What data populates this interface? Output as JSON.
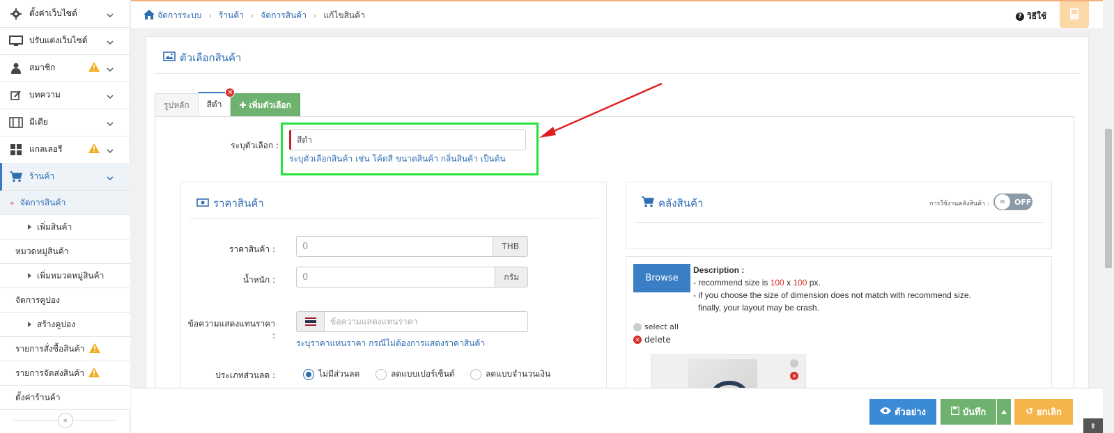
{
  "sidebar": {
    "items": [
      {
        "label": "ตั้งค่าเว็บไซต์",
        "icon": "gear-icon"
      },
      {
        "label": "ปรับแต่งเว็บไซต์",
        "icon": "monitor-icon"
      },
      {
        "label": "สมาชิก",
        "icon": "user-icon",
        "warning": true
      },
      {
        "label": "บทความ",
        "icon": "edit-icon"
      },
      {
        "label": "มีเดีย",
        "icon": "film-icon"
      },
      {
        "label": "แกลเลอรี",
        "icon": "grid-icon",
        "warning": true
      },
      {
        "label": "ร้านค้า",
        "icon": "cart-icon"
      }
    ],
    "shop_sub": [
      {
        "label": "จัดการสินค้า"
      },
      {
        "label": "เพิ่มสินค้า"
      },
      {
        "label": "หมวดหมู่สินค้า"
      },
      {
        "label": "เพิ่มหมวดหมู่สินค้า"
      },
      {
        "label": "จัดการคูปอง"
      },
      {
        "label": "สร้างคูปอง"
      },
      {
        "label": "รายการสั่งซื้อสินค้า"
      },
      {
        "label": "รายการจัดส่งสินค้า"
      },
      {
        "label": "ตั้งค่าร้านค้า"
      }
    ],
    "collapse_glyph": "«"
  },
  "breadcrumb": {
    "items": [
      "จัดการระบบ",
      "ร้านค้า",
      "จัดการสินค้า",
      "แก้ไขสินค้า"
    ]
  },
  "help_label": "วิธีใช้",
  "panel": {
    "title": "ตัวเลือกสินค้า",
    "tabs": [
      "รูปหลัก",
      "สีดำ",
      "เพิ่มตัวเลือก"
    ],
    "option_label": "ระบุตัวเลือก :",
    "option_value": "สีดำ",
    "option_help": "ระบุตัวเลือกสินค้า เช่น โค้ดสี ขนาดสินค้า กลิ่นสินค้า เป็นต้น"
  },
  "price": {
    "title": "ราคาสินค้า",
    "price_label": "ราคาสินค้า :",
    "price_value": "0",
    "price_unit": "THB",
    "weight_label": "น้ำหนัก :",
    "weight_value": "0",
    "weight_unit": "กรัม",
    "alt_label": "ข้อความแสดงแทนราคา",
    "alt_colon": ":",
    "alt_placeholder": "ข้อความแสดงแทนราคา",
    "alt_help": "ระบุราคาแทนราคา กรณีไม่ต้องการแสดงราคาสินค้า",
    "discount_label": "ประเภทส่วนลด :",
    "discount_options": [
      "ไม่มีส่วนลด",
      "ลดแบบเปอร์เซ็นต์",
      "ลดแบบจำนวนเงิน"
    ],
    "discount_selected": 0
  },
  "stock": {
    "title": "คลังสินค้า",
    "toggle_label": "การใช้งานคลังสินค้า :",
    "toggle_state": "OFF"
  },
  "image_upload": {
    "browse_label": "Browse",
    "desc_title": "Description :",
    "line1_pre": "- recommend size is ",
    "size_w": "100",
    "size_x": " x ",
    "size_h": "100",
    "line1_post": " px.",
    "line2": "- if you choose the size of dimension does not match with recommend size.",
    "line3": "finally, your layout may be crash.",
    "select_all": "select all",
    "delete": "delete"
  },
  "bottom": {
    "preview": "ตัวอย่าง",
    "save": "บันทึก",
    "cancel": "ยกเลิก",
    "to_top": "⇞"
  },
  "colors": {
    "accent": "#2f6db3",
    "highlight": "#23e23a",
    "arrow": "#e02020",
    "save": "#6fb26f",
    "cancel": "#f6b54a",
    "preview": "#3a8ad6"
  }
}
